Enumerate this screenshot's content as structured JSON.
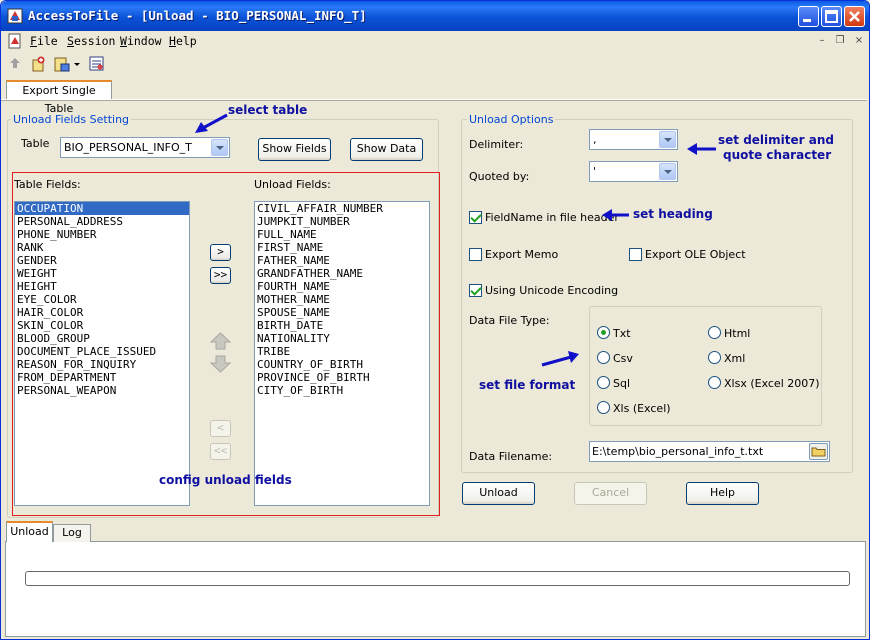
{
  "window": {
    "title": "AccessToFile - [Unload - BIO_PERSONAL_INFO_T]"
  },
  "menu": {
    "items": [
      {
        "key": "F",
        "rest": "ile"
      },
      {
        "key": "S",
        "rest": "ession"
      },
      {
        "key": "W",
        "rest": "indow"
      },
      {
        "key": "H",
        "rest": "elp"
      }
    ],
    "mdi": {
      "minimize": "–",
      "restore": "❐",
      "close": "×"
    }
  },
  "toolbar": {
    "icons": [
      "connect-icon",
      "new-session-icon",
      "open-icon",
      "dropdown-arrow-icon",
      "report-icon"
    ]
  },
  "tabs_top": [
    "Export Single Table"
  ],
  "unload_fields": {
    "group_label": "Unload Fields Setting",
    "table_label": "Table",
    "table_value": "BIO_PERSONAL_INFO_T",
    "show_fields": "Show Fields",
    "show_data": "Show Data",
    "table_fields_label": "Table Fields:",
    "unload_fields_label": "Unload Fields:",
    "table_fields": [
      "OCCUPATION",
      "PERSONAL_ADDRESS",
      "PHONE_NUMBER",
      "RANK",
      "GENDER",
      "WEIGHT",
      "HEIGHT",
      "EYE_COLOR",
      "HAIR_COLOR",
      "SKIN_COLOR",
      "BLOOD_GROUP",
      "DOCUMENT_PLACE_ISSUED",
      "REASON_FOR_INQUIRY",
      "FROM_DEPARTMENT",
      "PERSONAL_WEAPON"
    ],
    "selected_table_field": "OCCUPATION",
    "unload_fields": [
      "CIVIL_AFFAIR_NUMBER",
      "JUMPKIT_NUMBER",
      "FULL_NAME",
      "FIRST_NAME",
      "FATHER_NAME",
      "GRANDFATHER_NAME",
      "FOURTH_NAME",
      "MOTHER_NAME",
      "SPOUSE_NAME",
      "BIRTH_DATE",
      "NATIONALITY",
      "TRIBE",
      "COUNTRY_OF_BIRTH",
      "PROVINCE_OF_BIRTH",
      "CITY_OF_BIRTH"
    ],
    "move_buttons": {
      "add": ">",
      "add_all": ">>",
      "remove": "<",
      "remove_all": "<<"
    }
  },
  "unload_options": {
    "group_label": "Unload Options",
    "delimiter_label": "Delimiter:",
    "delimiter_value": ",",
    "quoted_label": "Quoted by:",
    "quoted_value": "'",
    "fieldname_header": {
      "label": "FieldName in file header",
      "checked": true
    },
    "export_memo": {
      "label": "Export Memo",
      "checked": false
    },
    "export_ole": {
      "label": "Export OLE Object",
      "checked": false
    },
    "unicode": {
      "label": "Using Unicode Encoding",
      "checked": true
    },
    "file_type_label": "Data File Type:",
    "file_types": [
      {
        "label": "Txt",
        "checked": true
      },
      {
        "label": "Html",
        "checked": false
      },
      {
        "label": "Csv",
        "checked": false
      },
      {
        "label": "Xml",
        "checked": false
      },
      {
        "label": "Sql",
        "checked": false
      },
      {
        "label": "Xlsx (Excel 2007)",
        "checked": false
      },
      {
        "label": "Xls (Excel)",
        "checked": false
      }
    ],
    "filename_label": "Data Filename:",
    "filename_value": "E:\\temp\\bio_personal_info_t.txt"
  },
  "buttons": {
    "unload": "Unload",
    "cancel": "Cancel",
    "help": "Help"
  },
  "tabs_bottom": [
    "Unload",
    "Log"
  ],
  "progress": {
    "value": 0
  },
  "annotations": {
    "select_table": "select table",
    "set_delimiter_1": "set  delimiter and",
    "set_delimiter_2": "quote character",
    "set_heading": "set heading",
    "set_file_format": "set file format",
    "config_fields": "config unload fields"
  },
  "colors": {
    "accent": "#0046d5",
    "annotation": "#1010a0",
    "highlight_box": "#e02020",
    "selection": "#316ac5"
  }
}
